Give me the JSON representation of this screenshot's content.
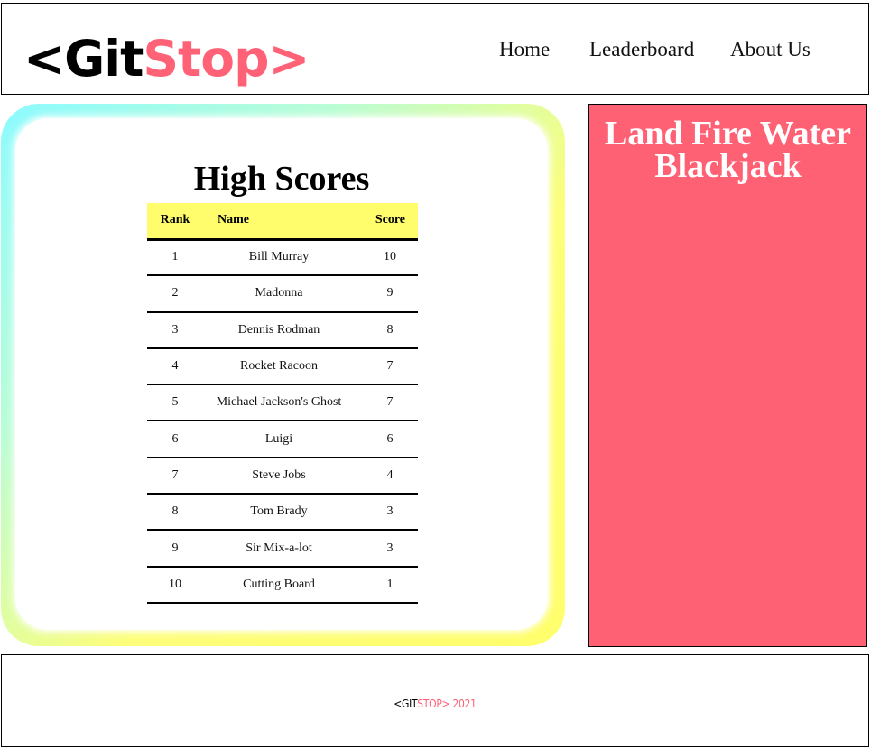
{
  "header": {
    "logo": {
      "prefix": "<Git",
      "suffix": "Stop>"
    },
    "nav": [
      {
        "label": "Home"
      },
      {
        "label": "Leaderboard"
      },
      {
        "label": "About Us"
      }
    ]
  },
  "leaderboard": {
    "title": "High Scores",
    "columns": {
      "rank": "Rank",
      "name": "Name",
      "score": "Score"
    },
    "rows": [
      {
        "rank": "1",
        "name": "Bill Murray",
        "score": "10"
      },
      {
        "rank": "2",
        "name": "Madonna",
        "score": "9"
      },
      {
        "rank": "3",
        "name": "Dennis Rodman",
        "score": "8"
      },
      {
        "rank": "4",
        "name": "Rocket Racoon",
        "score": "7"
      },
      {
        "rank": "5",
        "name": "Michael Jackson's Ghost",
        "score": "7"
      },
      {
        "rank": "6",
        "name": "Luigi",
        "score": "6"
      },
      {
        "rank": "7",
        "name": "Steve Jobs",
        "score": "4"
      },
      {
        "rank": "8",
        "name": "Tom Brady",
        "score": "3"
      },
      {
        "rank": "9",
        "name": "Sir Mix-a-lot",
        "score": "3"
      },
      {
        "rank": "10",
        "name": "Cutting Board",
        "score": "1"
      }
    ]
  },
  "game_panel": {
    "title_line1": "Land Fire Water",
    "title_line2": "Blackjack"
  },
  "footer": {
    "prefix": "<GIT",
    "suffix": "STOP> 2021"
  },
  "colors": {
    "brand_pink": "#ff6176",
    "header_yellow": "#fffd6b",
    "gradient_cyan": "#8dfbff",
    "gradient_yellow": "#fffe6b"
  }
}
